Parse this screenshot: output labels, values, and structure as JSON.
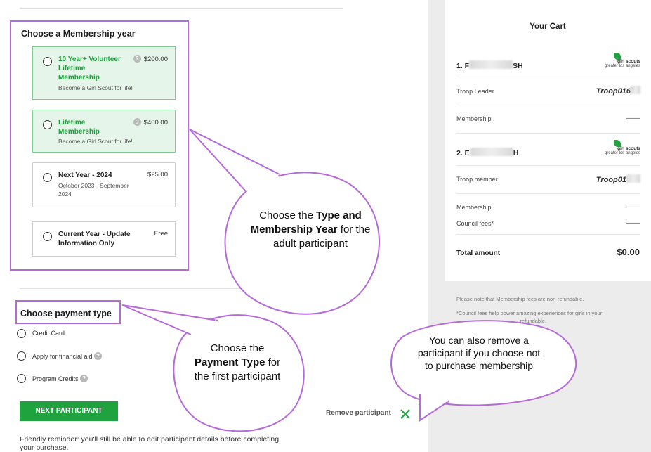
{
  "membership": {
    "title": "Choose a Membership year",
    "options": [
      {
        "name": "10 Year+ Volunteer Lifetime Membership",
        "line1": "10 Year+ Volunteer",
        "line2": "Lifetime",
        "line3": "Membership",
        "sub": "Become a Girl Scout for life!",
        "price": "$200.00",
        "help": "?"
      },
      {
        "name": "Lifetime Membership",
        "line1": "Lifetime",
        "line2": "Membership",
        "sub": "Become a Girl Scout for life!",
        "price": "$400.00",
        "help": "?"
      },
      {
        "name": "Next Year - 2024",
        "sub1": "October 2023 - September",
        "sub2": "2024",
        "price": "$25.00"
      },
      {
        "name": "Current Year - Update Information Only",
        "line1": "Current Year - Update",
        "line2": "Information Only",
        "price": "Free"
      }
    ]
  },
  "payment": {
    "title": "Choose payment type",
    "options": [
      "Credit Card",
      "Apply for financial aid",
      "Program Credits"
    ]
  },
  "next_button": "NEXT PARTICIPANT",
  "reminder": "Friendly reminder: you'll still be able to edit participant details before completing your purchase.",
  "remove_participant": "Remove participant",
  "cart": {
    "title": "Your Cart",
    "participant1": {
      "prefix": "1. F",
      "suffix": "SH",
      "role": "Troop Leader",
      "troop": "Troop016",
      "membership_label": "Membership",
      "membership_val": "——"
    },
    "participant2": {
      "prefix": "2. E",
      "suffix": "H",
      "role": "Troop member",
      "troop": "Troop01",
      "membership_label": "Membership",
      "membership_val": "——",
      "council_label": "Council fees*",
      "council_val": "——"
    },
    "logo_line1": "girl scouts",
    "logo_line2": "greater los angeles",
    "total_label": "Total amount",
    "total_value": "$0.00"
  },
  "notes": {
    "note1": "Please note that Membership fees are non-refundable.",
    "note2": "*Council fees help power amazing experiences for girls in your",
    "note3": "-refundable."
  },
  "callouts": {
    "c1_pre": "Choose the ",
    "c1_bold": "Type and Membership Year",
    "c1_post": " for the adult participant",
    "c2_pre": "Choose the ",
    "c2_bold": "Payment Type",
    "c2_post": " for the first participant",
    "c3": "You can also remove a participant if you choose not to purchase membership"
  },
  "colors": {
    "highlight": "#b46ad8",
    "brand_green": "#1fa33e"
  }
}
